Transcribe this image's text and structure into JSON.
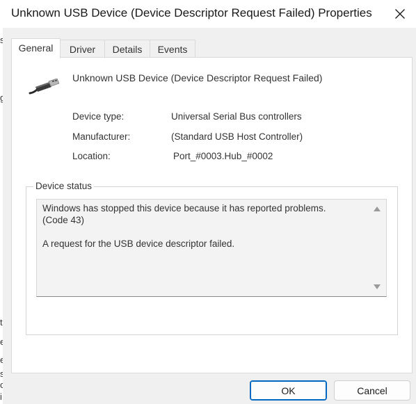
{
  "window": {
    "title": "Unknown USB Device (Device Descriptor Request Failed) Properties"
  },
  "background_fragments": [
    "s",
    "g",
    "t",
    "e",
    "e",
    "s",
    "c",
    "i"
  ],
  "tabs": [
    {
      "label": "General",
      "active": true
    },
    {
      "label": "Driver",
      "active": false
    },
    {
      "label": "Details",
      "active": false
    },
    {
      "label": "Events",
      "active": false
    }
  ],
  "general": {
    "device_name": "Unknown USB Device (Device Descriptor Request Failed)",
    "icon": "usb-connector-icon",
    "properties": [
      {
        "label": "Device type:",
        "value": "Universal Serial Bus controllers"
      },
      {
        "label": "Manufacturer:",
        "value": "(Standard USB Host Controller)"
      },
      {
        "label": "Location:",
        "value": "Port_#0003.Hub_#0002"
      }
    ],
    "status_legend": "Device status",
    "status_text": "Windows has stopped this device because it has reported problems.\n(Code 43)\n\nA request for the USB device descriptor failed."
  },
  "buttons": {
    "ok": "OK",
    "cancel": "Cancel"
  },
  "colors": {
    "accent": "#0067c0",
    "dialog_bg": "#f0f0f0",
    "panel_bg": "#ffffff"
  }
}
